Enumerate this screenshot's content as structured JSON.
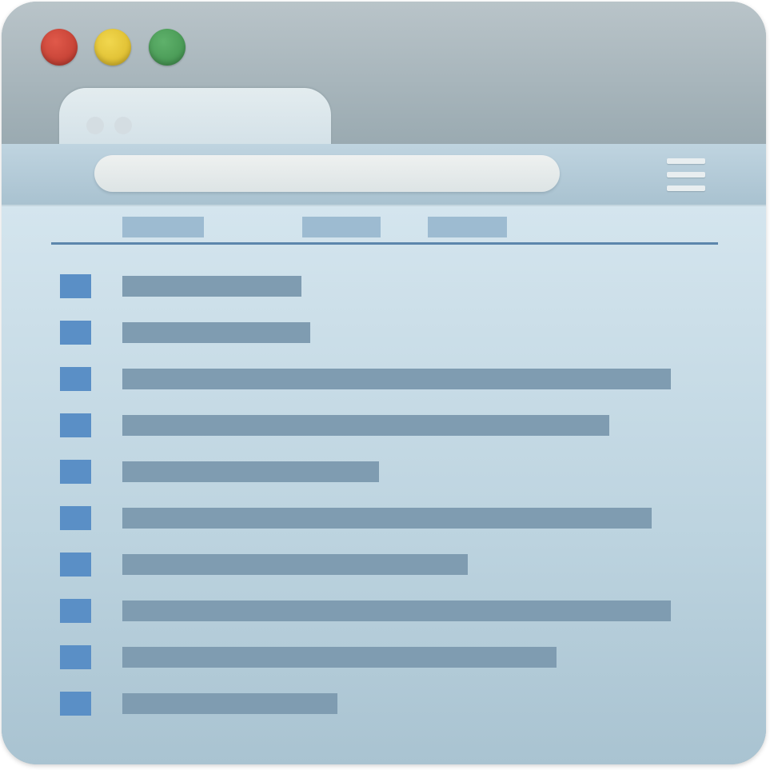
{
  "window": {
    "title_bar": {
      "traffic_lights": [
        {
          "name": "close",
          "color": "#d0463a"
        },
        {
          "name": "minimize",
          "color": "#e8c83a"
        },
        {
          "name": "maximize",
          "color": "#4fa25c"
        }
      ]
    },
    "tab": {
      "label": ""
    },
    "toolbar": {
      "address_bar": {
        "value": "",
        "placeholder": ""
      },
      "menu_icon": "hamburger-menu-icon"
    },
    "list": {
      "columns": [
        "",
        "",
        ""
      ],
      "rows": [
        {
          "icon": "file-icon",
          "label": ""
        },
        {
          "icon": "file-icon",
          "label": ""
        },
        {
          "icon": "file-icon",
          "label": ""
        },
        {
          "icon": "file-icon",
          "label": ""
        },
        {
          "icon": "file-icon",
          "label": ""
        },
        {
          "icon": "file-icon",
          "label": ""
        },
        {
          "icon": "file-icon",
          "label": ""
        },
        {
          "icon": "file-icon",
          "label": ""
        },
        {
          "icon": "file-icon",
          "label": ""
        },
        {
          "icon": "file-icon",
          "label": ""
        }
      ]
    }
  },
  "colors": {
    "accent": "#5a8fc6",
    "divider": "#5c86ac",
    "placeholder_text": "#7f9cb1"
  }
}
